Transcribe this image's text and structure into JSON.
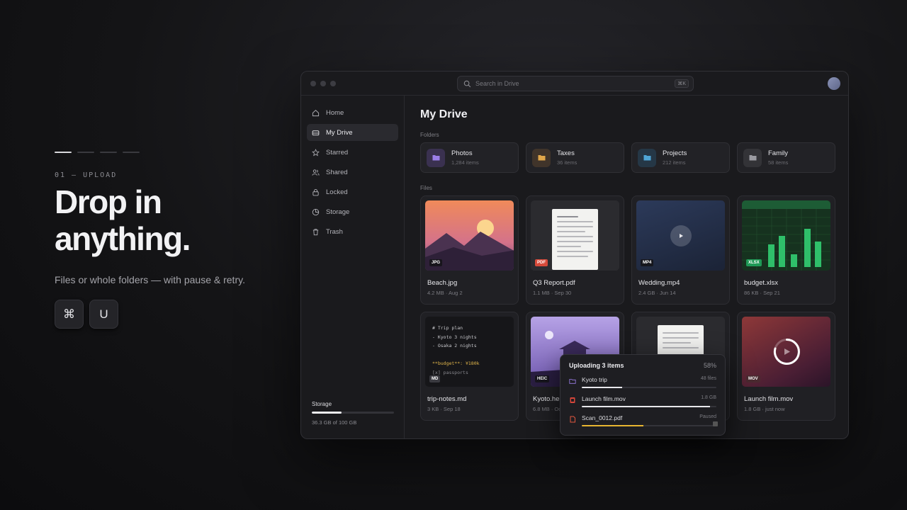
{
  "promo": {
    "step_label": "01 — UPLOAD",
    "headline_1": "Drop in",
    "headline_2": "anything.",
    "subline": "Files or whole folders — with pause & retry.",
    "key_1": "⌘",
    "key_2": "U",
    "steps_total": 4,
    "step_active": 1
  },
  "window": {
    "search": {
      "placeholder": "Search in Drive",
      "shortcut": "⌘K"
    }
  },
  "sidebar": {
    "items": [
      {
        "label": "Home",
        "icon": "home-icon"
      },
      {
        "label": "My Drive",
        "icon": "drive-icon",
        "active": true
      },
      {
        "label": "Starred",
        "icon": "star-icon"
      },
      {
        "label": "Shared",
        "icon": "users-icon"
      },
      {
        "label": "Locked",
        "icon": "lock-icon"
      },
      {
        "label": "Storage",
        "icon": "pie-chart-icon"
      },
      {
        "label": "Trash",
        "icon": "trash-icon"
      }
    ],
    "storage": {
      "title": "Storage",
      "text": "36.3 GB of 100 GB",
      "used_fraction": 0.363
    }
  },
  "main": {
    "title": "My Drive",
    "folders_label": "Folders",
    "files_label": "Files",
    "folders": [
      {
        "name": "Photos",
        "meta": "1,284 items",
        "color": "#9b7ee8",
        "bg": "#3a3150"
      },
      {
        "name": "Taxes",
        "meta": "36 items",
        "color": "#e0a64a",
        "bg": "#40342a"
      },
      {
        "name": "Projects",
        "meta": "212 items",
        "color": "#4fa5d6",
        "bg": "#253746"
      },
      {
        "name": "Family",
        "meta": "58 items",
        "color": "#9a9aa0",
        "bg": "#333337"
      }
    ],
    "files": [
      {
        "name": "Beach.jpg",
        "meta": "4.2 MB · Aug 2",
        "badge": "JPG",
        "kind": "image"
      },
      {
        "name": "Q3 Report.pdf",
        "meta": "1.1 MB · Sep 30",
        "badge": "PDF",
        "kind": "pdf",
        "badge_color": "#d64a3a"
      },
      {
        "name": "Wedding.mp4",
        "meta": "2.4 GB · Jun 14",
        "badge": "MP4",
        "kind": "video"
      },
      {
        "name": "budget.xlsx",
        "meta": "86 KB · Sep 21",
        "badge": "XLSX",
        "kind": "sheet",
        "badge_color": "#1f9a56"
      },
      {
        "name": "trip-notes.md",
        "meta": "3 KB · Sep 18",
        "badge": "MD",
        "kind": "code"
      },
      {
        "name": "Kyoto.heic",
        "meta": "6.8 MB · Oct 3",
        "badge": "HEIC",
        "kind": "photo2"
      },
      {
        "name": "Scan_0012.pdf",
        "meta": "",
        "badge": "",
        "kind": "pdf2"
      },
      {
        "name": "Launch film.mov",
        "meta": "1.8 GB · just now",
        "badge": "MOV",
        "kind": "mov"
      }
    ],
    "notes_code": [
      "# Trip plan",
      "- Kyoto 3 nights",
      "- Osaka 2 nights",
      "",
      "**budget**: ¥180k",
      "[x] passports"
    ]
  },
  "upload": {
    "title": "Uploading 3 items",
    "percent": "58%",
    "items": [
      {
        "name": "Kyoto trip",
        "status": "48 files",
        "progress": 0.3,
        "icon": "folder-icon",
        "state": "uploading"
      },
      {
        "name": "Launch film.mov",
        "status": "1.8 GB",
        "progress": 0.95,
        "icon": "film-icon",
        "state": "uploading"
      },
      {
        "name": "Scan_0012.pdf",
        "status": "Paused",
        "progress": 0.46,
        "icon": "pdf-icon",
        "state": "paused"
      }
    ]
  }
}
